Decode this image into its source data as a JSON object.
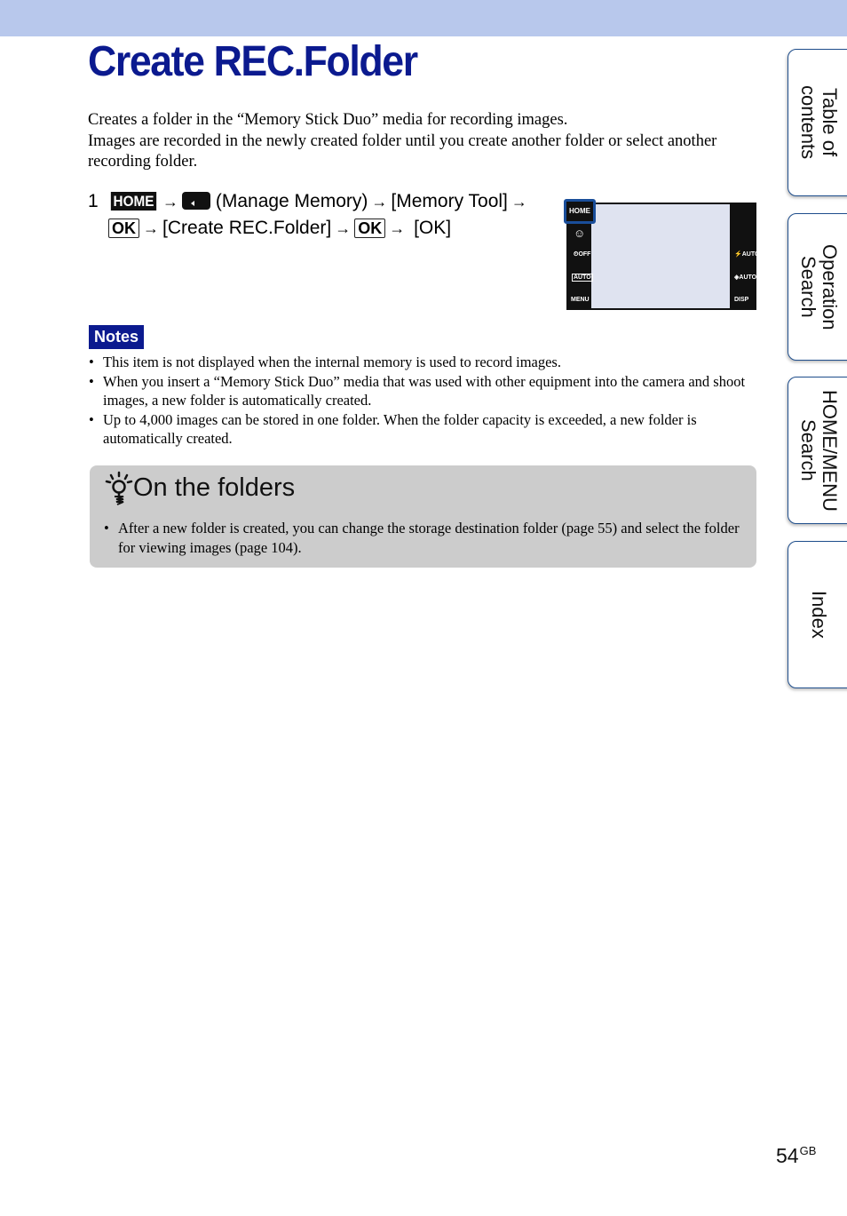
{
  "header": {
    "title": "Create REC.Folder"
  },
  "intro": {
    "lines": [
      "Creates a folder in the “Memory Stick Duo” media for recording images.",
      "Images are recorded in the newly created folder until you create another folder or select another recording folder."
    ]
  },
  "step": {
    "number": "1",
    "home_key": "HOME",
    "arrow": "→",
    "manage_memory": "(Manage Memory)",
    "memory_tool": "[Memory Tool]",
    "ok_key": "OK",
    "create_rec_folder": "[Create REC.Folder]",
    "final": "[OK]"
  },
  "camera_screen": {
    "left_icons": [
      "HOME",
      "☺",
      "⏲OFF",
      "AUTO",
      "MENU"
    ],
    "right_icons": [
      "⚡AUTO",
      "◈AUTO",
      "DISP"
    ],
    "highlight_color": "#1a4e9a"
  },
  "notes": {
    "badge": "Notes",
    "items": [
      "This item is not displayed when the internal memory is used to record images.",
      "When you insert a “Memory Stick Duo” media that was used with other equipment into the camera and shoot images, a new folder is automatically created.",
      "Up to 4,000 images can be stored in one folder. When the folder capacity is exceeded, a new folder is automatically created."
    ]
  },
  "tip": {
    "title": "On the folders",
    "items": [
      "After a new folder is created, you can change the storage destination folder (page 55) and select the folder for viewing images (page 104)."
    ]
  },
  "side_tabs": [
    {
      "label": "Table of contents"
    },
    {
      "label": "Operation Search"
    },
    {
      "label": "HOME/MENU Search"
    },
    {
      "label": "Index"
    }
  ],
  "footer": {
    "page_number": "54",
    "suffix": "GB"
  },
  "colors": {
    "band": "#b8c8ec",
    "title": "#0b1a8f",
    "tab_border": "#1f4e8c",
    "tip_bg": "#cccccc"
  }
}
